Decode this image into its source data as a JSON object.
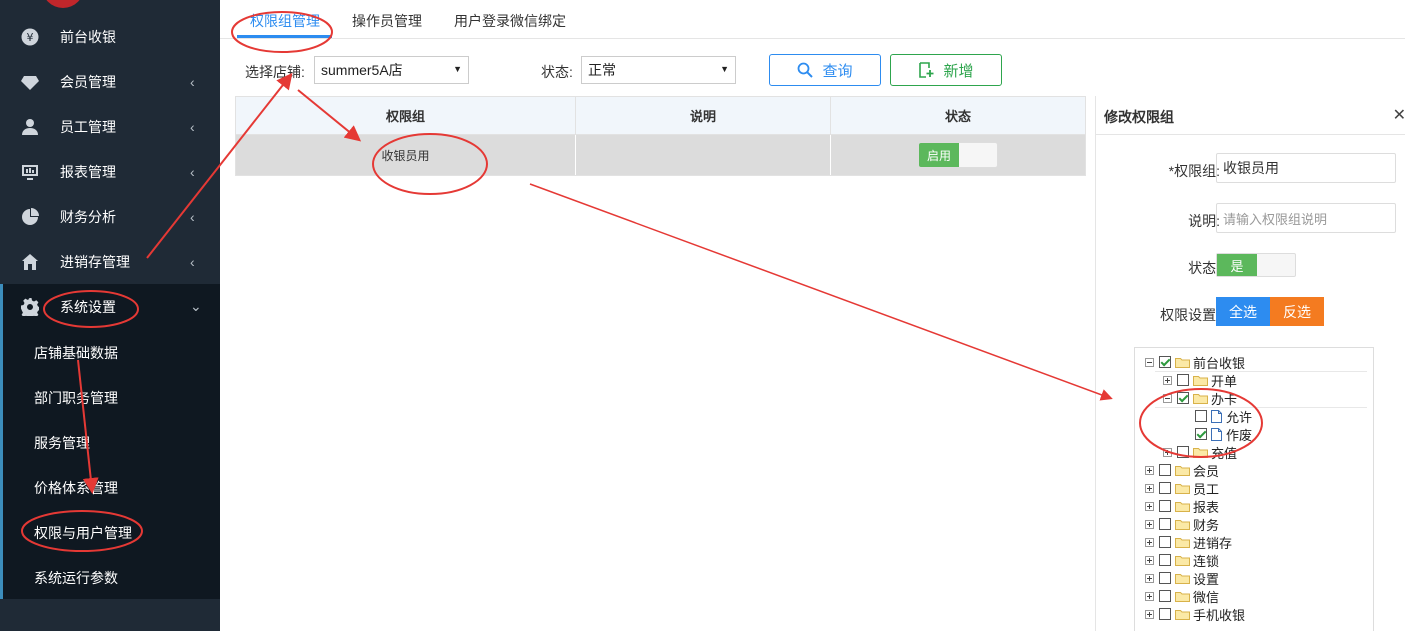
{
  "colors": {
    "sidebar_bg": "#1f2a36",
    "submenu_bg": "#0f1821",
    "primary": "#2d8cf0",
    "success": "#5cb85c",
    "warning": "#f47b20",
    "annotation": "#e53935"
  },
  "sidebar": {
    "items": [
      {
        "label": "前台收银",
        "icon": "yen-coin-icon",
        "chevron": ""
      },
      {
        "label": "会员管理",
        "icon": "diamond-icon",
        "chevron": "‹"
      },
      {
        "label": "员工管理",
        "icon": "user-icon",
        "chevron": "‹"
      },
      {
        "label": "报表管理",
        "icon": "monitor-icon",
        "chevron": "‹"
      },
      {
        "label": "财务分析",
        "icon": "pie-chart-icon",
        "chevron": "‹"
      },
      {
        "label": "进销存管理",
        "icon": "home-icon",
        "chevron": "‹"
      },
      {
        "label": "系统设置",
        "icon": "gear-icon",
        "chevron": "⌄"
      }
    ],
    "submenu": [
      "店铺基础数据",
      "部门职务管理",
      "服务管理",
      "价格体系管理",
      "权限与用户管理",
      "系统运行参数"
    ]
  },
  "tabs": [
    "权限组管理",
    "操作员管理",
    "用户登录微信绑定"
  ],
  "filters": {
    "store_label": "选择店铺:",
    "store_value": "summer5A店",
    "status_label": "状态:",
    "status_value": "正常"
  },
  "buttons": {
    "query": "查询",
    "add": "新增"
  },
  "table": {
    "headers": [
      "权限组",
      "说明",
      "状态"
    ],
    "rows": [
      {
        "group": "收银员用",
        "desc": "",
        "status": "启用"
      }
    ]
  },
  "panel": {
    "title": "修改权限组",
    "close": "✕",
    "name_label": "*权限组:",
    "name_value": "收银员用",
    "desc_label": "说明:",
    "desc_placeholder": "请输入权限组说明",
    "status_label": "状态:",
    "status_value": "是",
    "perm_label": "权限设置:",
    "select_all": "全选",
    "invert": "反选"
  },
  "tree": [
    {
      "label": "前台收银",
      "level": 0,
      "expander": "minus",
      "checked": true,
      "kind": "folder"
    },
    {
      "label": "开单",
      "level": 1,
      "expander": "plus",
      "checked": false,
      "kind": "folder"
    },
    {
      "label": "办卡",
      "level": 1,
      "expander": "minus",
      "checked": true,
      "kind": "folder"
    },
    {
      "label": "允许",
      "level": 2,
      "expander": "",
      "checked": false,
      "kind": "doc"
    },
    {
      "label": "作废",
      "level": 2,
      "expander": "",
      "checked": true,
      "kind": "doc"
    },
    {
      "label": "充值",
      "level": 1,
      "expander": "plus",
      "checked": false,
      "kind": "folder"
    },
    {
      "label": "会员",
      "level": 0,
      "expander": "plus",
      "checked": false,
      "kind": "folder"
    },
    {
      "label": "员工",
      "level": 0,
      "expander": "plus",
      "checked": false,
      "kind": "folder"
    },
    {
      "label": "报表",
      "level": 0,
      "expander": "plus",
      "checked": false,
      "kind": "folder"
    },
    {
      "label": "财务",
      "level": 0,
      "expander": "plus",
      "checked": false,
      "kind": "folder"
    },
    {
      "label": "进销存",
      "level": 0,
      "expander": "plus",
      "checked": false,
      "kind": "folder"
    },
    {
      "label": "连锁",
      "level": 0,
      "expander": "plus",
      "checked": false,
      "kind": "folder"
    },
    {
      "label": "设置",
      "level": 0,
      "expander": "plus",
      "checked": false,
      "kind": "folder"
    },
    {
      "label": "微信",
      "level": 0,
      "expander": "plus",
      "checked": false,
      "kind": "folder"
    },
    {
      "label": "手机收银",
      "level": 0,
      "expander": "plus",
      "checked": false,
      "kind": "folder"
    }
  ]
}
